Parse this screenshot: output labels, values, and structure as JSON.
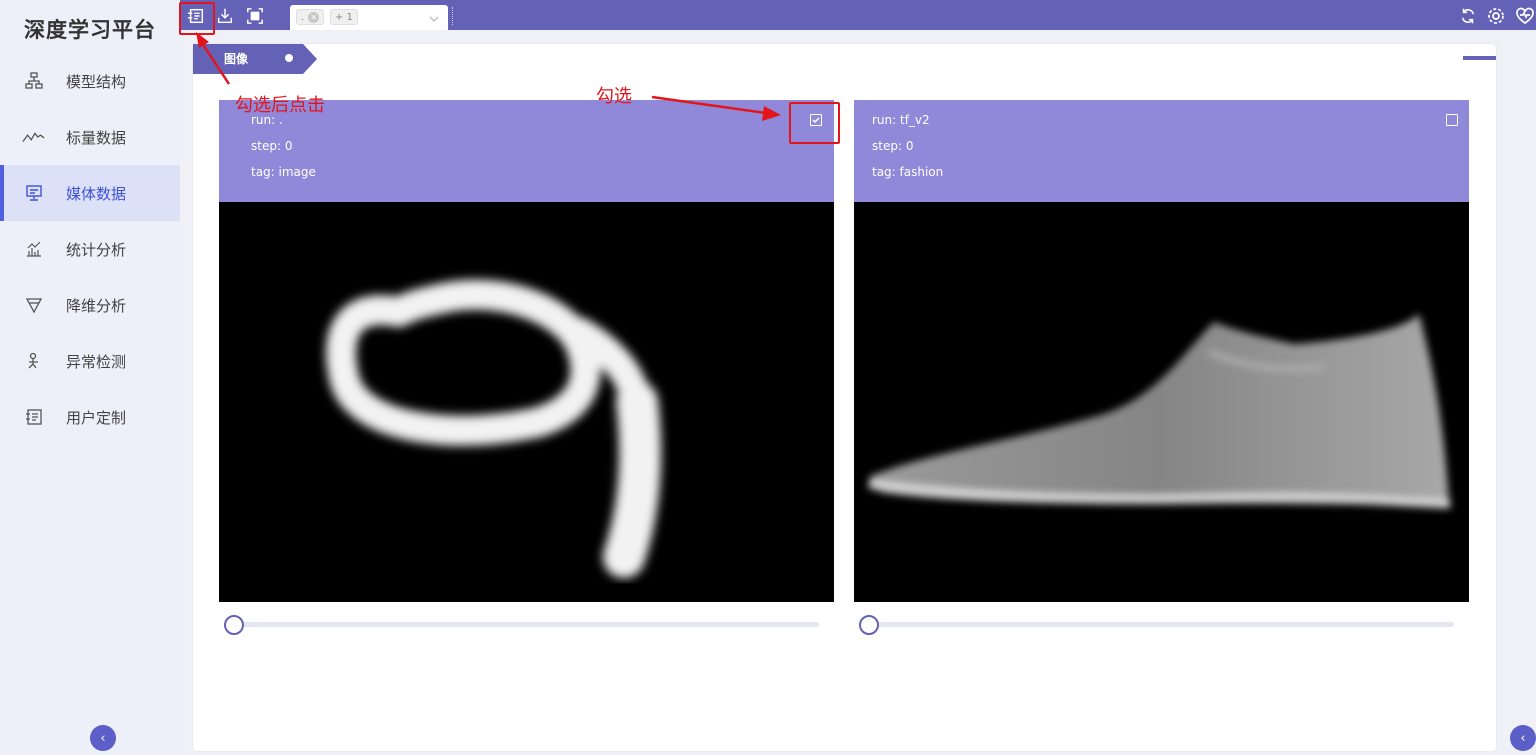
{
  "sidebar": {
    "brand": "深度学习平台",
    "items": [
      {
        "label": "模型结构",
        "icon": "model-structure-icon"
      },
      {
        "label": "标量数据",
        "icon": "scalar-line-icon"
      },
      {
        "label": "媒体数据",
        "icon": "media-monitor-icon",
        "active": true
      },
      {
        "label": "统计分析",
        "icon": "statistics-chart-icon"
      },
      {
        "label": "降维分析",
        "icon": "dimension-funnel-icon"
      },
      {
        "label": "异常检测",
        "icon": "anomaly-person-icon"
      },
      {
        "label": "用户定制",
        "icon": "custom-board-icon"
      }
    ],
    "collapse_glyph": "‹"
  },
  "toolbar": {
    "icons": [
      "compare-board-icon",
      "download-icon",
      "fullscreen-icon"
    ],
    "run_select": {
      "chip_label": ".",
      "more_count": "+ 1"
    },
    "right_icons": [
      "refresh-icon",
      "settings-icon",
      "health-icon"
    ]
  },
  "tab": {
    "label": "图像"
  },
  "cards": [
    {
      "run": "run: .",
      "step": "step: 0",
      "tag": "tag: image",
      "checked": true
    },
    {
      "run": "run: tf_v2",
      "step": "step: 0",
      "tag": "tag: fashion",
      "checked": false
    }
  ],
  "annotations": {
    "select_then_click": "勾选后点击",
    "select": "勾选"
  },
  "colors": {
    "accent": "#6462b7",
    "card_header": "#9089d9",
    "annotation": "#e3151a",
    "sidebar_bg": "#eef0f9"
  }
}
